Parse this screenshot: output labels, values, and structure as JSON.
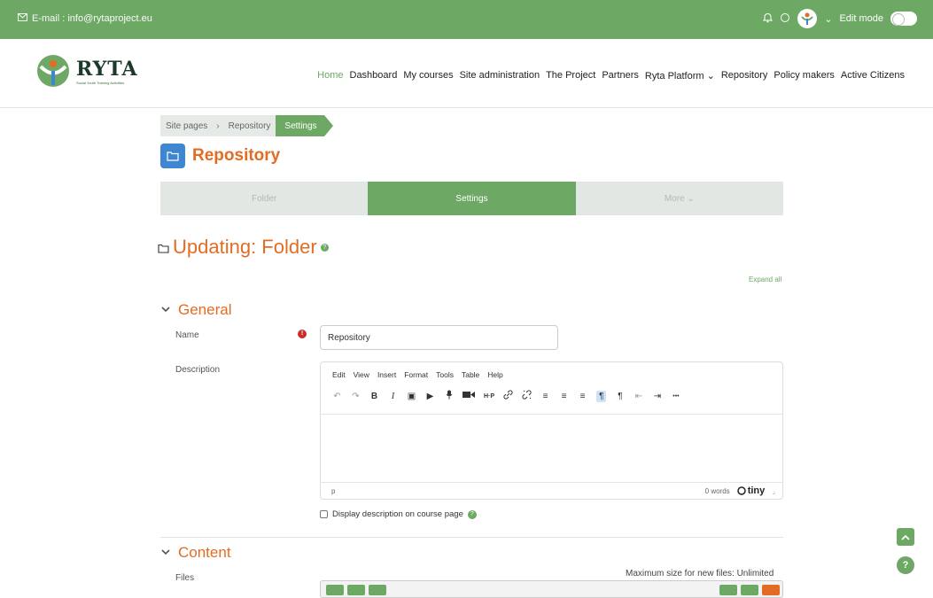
{
  "topbar": {
    "email": "E-mail : info@rytaproject.eu",
    "edit_mode": "Edit mode",
    "avatar_caret": "⌄"
  },
  "brand": {
    "name": "RYTA",
    "tagline": "Social Youth Training Activities"
  },
  "nav": [
    {
      "label": "Home"
    },
    {
      "label": "Dashboard"
    },
    {
      "label": "My courses"
    },
    {
      "label": "Site administration"
    },
    {
      "label": "The Project"
    },
    {
      "label": "Partners"
    },
    {
      "label": "Ryta Platform ⌄"
    },
    {
      "label": "Repository"
    },
    {
      "label": "Policy makers"
    },
    {
      "label": "Active Citizens"
    }
  ],
  "breadcrumb": {
    "items": [
      "Site pages",
      "Repository"
    ],
    "separator": "›",
    "current": "Settings"
  },
  "page": {
    "title": "Repository",
    "heading": "Updating: Folder",
    "expand_all": "Expand all"
  },
  "tabs": [
    {
      "label": "Folder"
    },
    {
      "label": "Settings"
    },
    {
      "label": "More ⌄"
    }
  ],
  "general": {
    "title": "General",
    "name_label": "Name",
    "name_value": "Repository",
    "description_label": "Description",
    "display_description": "Display description on course page"
  },
  "editor": {
    "menu": [
      "Edit",
      "View",
      "Insert",
      "Format",
      "Tools",
      "Table",
      "Help"
    ],
    "path": "p",
    "word_count": "0 words",
    "brand": "tiny",
    "toolbar": {
      "undo": "↶",
      "redo": "↷",
      "bold": "B",
      "italic": "I",
      "image": "▣",
      "media": "▶",
      "record_audio": "🎙",
      "record_video": "■",
      "h5p": "H·P",
      "link": "🔗",
      "unlink": "✂",
      "align_left": "≡",
      "align_center": "≡",
      "align_right": "≡",
      "ltr": "¶",
      "rtl": "¶",
      "outdent": "⇤",
      "indent": "⇥",
      "more": "•••"
    }
  },
  "content": {
    "title": "Content",
    "files_label": "Files",
    "max_size": "Maximum size for new files: Unlimited"
  },
  "colors": {
    "brand_green": "#6ea865",
    "accent_orange": "#e36c24",
    "folder_blue": "#3f86d1"
  }
}
